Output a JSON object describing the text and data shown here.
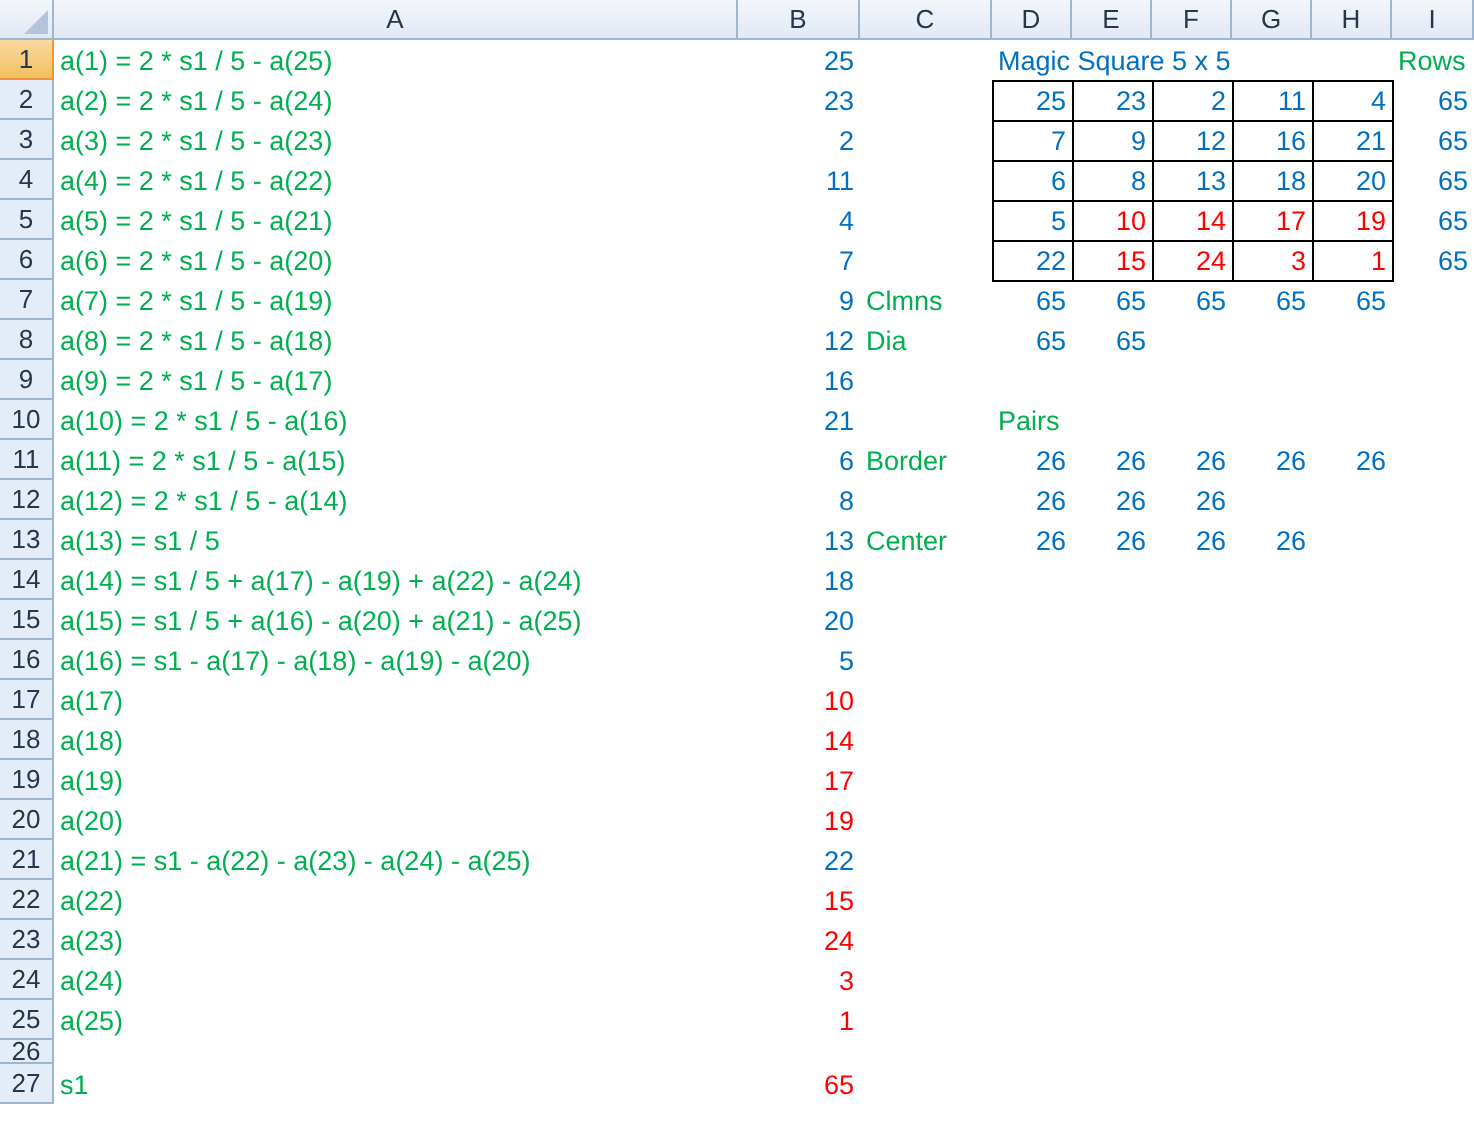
{
  "sheet": {
    "columns": [
      {
        "label": "A",
        "selected": false
      },
      {
        "label": "B",
        "selected": false
      },
      {
        "label": "C",
        "selected": false
      },
      {
        "label": "D",
        "selected": false
      },
      {
        "label": "E",
        "selected": false
      },
      {
        "label": "F",
        "selected": false
      },
      {
        "label": "G",
        "selected": false
      },
      {
        "label": "H",
        "selected": false
      },
      {
        "label": "I",
        "selected": false
      }
    ],
    "rows": [
      {
        "label": "1",
        "selected": true,
        "cells": [
          {
            "text": "a(1) = 2 * s1 / 5 - a(25)",
            "kind": "text",
            "color": "#00b050",
            "bordered": false
          },
          {
            "text": "25",
            "kind": "number",
            "color": "#0070c0",
            "bordered": false
          },
          null,
          {
            "text": "Magic Square 5 x 5",
            "kind": "text",
            "color": "#0070c0",
            "bordered": false
          },
          null,
          null,
          null,
          null,
          {
            "text": "Rows",
            "kind": "text",
            "color": "#00b050",
            "bordered": false
          }
        ]
      },
      {
        "label": "2",
        "selected": false,
        "cells": [
          {
            "text": "a(2) = 2 * s1 / 5 - a(24)",
            "kind": "text",
            "color": "#00b050",
            "bordered": false
          },
          {
            "text": "23",
            "kind": "number",
            "color": "#0070c0",
            "bordered": false
          },
          null,
          {
            "text": "25",
            "kind": "number",
            "color": "#0070c0",
            "bordered": true
          },
          {
            "text": "23",
            "kind": "number",
            "color": "#0070c0",
            "bordered": true
          },
          {
            "text": "2",
            "kind": "number",
            "color": "#0070c0",
            "bordered": true
          },
          {
            "text": "11",
            "kind": "number",
            "color": "#0070c0",
            "bordered": true
          },
          {
            "text": "4",
            "kind": "number",
            "color": "#0070c0",
            "bordered": true
          },
          {
            "text": "65",
            "kind": "number",
            "color": "#0070c0",
            "bordered": false
          }
        ]
      },
      {
        "label": "3",
        "selected": false,
        "cells": [
          {
            "text": "a(3) = 2 * s1 / 5 - a(23)",
            "kind": "text",
            "color": "#00b050",
            "bordered": false
          },
          {
            "text": "2",
            "kind": "number",
            "color": "#0070c0",
            "bordered": false
          },
          null,
          {
            "text": "7",
            "kind": "number",
            "color": "#0070c0",
            "bordered": true
          },
          {
            "text": "9",
            "kind": "number",
            "color": "#0070c0",
            "bordered": true
          },
          {
            "text": "12",
            "kind": "number",
            "color": "#0070c0",
            "bordered": true
          },
          {
            "text": "16",
            "kind": "number",
            "color": "#0070c0",
            "bordered": true
          },
          {
            "text": "21",
            "kind": "number",
            "color": "#0070c0",
            "bordered": true
          },
          {
            "text": "65",
            "kind": "number",
            "color": "#0070c0",
            "bordered": false
          }
        ]
      },
      {
        "label": "4",
        "selected": false,
        "cells": [
          {
            "text": "a(4) = 2 * s1 / 5 - a(22)",
            "kind": "text",
            "color": "#00b050",
            "bordered": false
          },
          {
            "text": "11",
            "kind": "number",
            "color": "#0070c0",
            "bordered": false
          },
          null,
          {
            "text": "6",
            "kind": "number",
            "color": "#0070c0",
            "bordered": true
          },
          {
            "text": "8",
            "kind": "number",
            "color": "#0070c0",
            "bordered": true
          },
          {
            "text": "13",
            "kind": "number",
            "color": "#0070c0",
            "bordered": true
          },
          {
            "text": "18",
            "kind": "number",
            "color": "#0070c0",
            "bordered": true
          },
          {
            "text": "20",
            "kind": "number",
            "color": "#0070c0",
            "bordered": true
          },
          {
            "text": "65",
            "kind": "number",
            "color": "#0070c0",
            "bordered": false
          }
        ]
      },
      {
        "label": "5",
        "selected": false,
        "cells": [
          {
            "text": "a(5) = 2 * s1 / 5 - a(21)",
            "kind": "text",
            "color": "#00b050",
            "bordered": false
          },
          {
            "text": "4",
            "kind": "number",
            "color": "#0070c0",
            "bordered": false
          },
          null,
          {
            "text": "5",
            "kind": "number",
            "color": "#0070c0",
            "bordered": true
          },
          {
            "text": "10",
            "kind": "number",
            "color": "#ff0000",
            "bordered": true
          },
          {
            "text": "14",
            "kind": "number",
            "color": "#ff0000",
            "bordered": true
          },
          {
            "text": "17",
            "kind": "number",
            "color": "#ff0000",
            "bordered": true
          },
          {
            "text": "19",
            "kind": "number",
            "color": "#ff0000",
            "bordered": true
          },
          {
            "text": "65",
            "kind": "number",
            "color": "#0070c0",
            "bordered": false
          }
        ]
      },
      {
        "label": "6",
        "selected": false,
        "cells": [
          {
            "text": "a(6) = 2 * s1 / 5 - a(20)",
            "kind": "text",
            "color": "#00b050",
            "bordered": false
          },
          {
            "text": "7",
            "kind": "number",
            "color": "#0070c0",
            "bordered": false
          },
          null,
          {
            "text": "22",
            "kind": "number",
            "color": "#0070c0",
            "bordered": true
          },
          {
            "text": "15",
            "kind": "number",
            "color": "#ff0000",
            "bordered": true
          },
          {
            "text": "24",
            "kind": "number",
            "color": "#ff0000",
            "bordered": true
          },
          {
            "text": "3",
            "kind": "number",
            "color": "#ff0000",
            "bordered": true
          },
          {
            "text": "1",
            "kind": "number",
            "color": "#ff0000",
            "bordered": true
          },
          {
            "text": "65",
            "kind": "number",
            "color": "#0070c0",
            "bordered": false
          }
        ]
      },
      {
        "label": "7",
        "selected": false,
        "cells": [
          {
            "text": "a(7) = 2 * s1 / 5 - a(19)",
            "kind": "text",
            "color": "#00b050",
            "bordered": false
          },
          {
            "text": "9",
            "kind": "number",
            "color": "#0070c0",
            "bordered": false
          },
          {
            "text": "Clmns",
            "kind": "text",
            "color": "#00b050",
            "bordered": false
          },
          {
            "text": "65",
            "kind": "number",
            "color": "#0070c0",
            "bordered": false
          },
          {
            "text": "65",
            "kind": "number",
            "color": "#0070c0",
            "bordered": false
          },
          {
            "text": "65",
            "kind": "number",
            "color": "#0070c0",
            "bordered": false
          },
          {
            "text": "65",
            "kind": "number",
            "color": "#0070c0",
            "bordered": false
          },
          {
            "text": "65",
            "kind": "number",
            "color": "#0070c0",
            "bordered": false
          }
        ]
      },
      {
        "label": "8",
        "selected": false,
        "cells": [
          {
            "text": "a(8) = 2 * s1 / 5 - a(18)",
            "kind": "text",
            "color": "#00b050",
            "bordered": false
          },
          {
            "text": "12",
            "kind": "number",
            "color": "#0070c0",
            "bordered": false
          },
          {
            "text": "Dia",
            "kind": "text",
            "color": "#00b050",
            "bordered": false
          },
          {
            "text": "65",
            "kind": "number",
            "color": "#0070c0",
            "bordered": false
          },
          {
            "text": "65",
            "kind": "number",
            "color": "#0070c0",
            "bordered": false
          }
        ]
      },
      {
        "label": "9",
        "selected": false,
        "cells": [
          {
            "text": "a(9) = 2 * s1 / 5 - a(17)",
            "kind": "text",
            "color": "#00b050",
            "bordered": false
          },
          {
            "text": "16",
            "kind": "number",
            "color": "#0070c0",
            "bordered": false
          }
        ]
      },
      {
        "label": "10",
        "selected": false,
        "cells": [
          {
            "text": "a(10) = 2 * s1 / 5 - a(16)",
            "kind": "text",
            "color": "#00b050",
            "bordered": false
          },
          {
            "text": "21",
            "kind": "number",
            "color": "#0070c0",
            "bordered": false
          },
          null,
          {
            "text": "Pairs",
            "kind": "text",
            "color": "#00b050",
            "bordered": false
          }
        ]
      },
      {
        "label": "11",
        "selected": false,
        "cells": [
          {
            "text": "a(11) = 2 * s1 / 5 - a(15)",
            "kind": "text",
            "color": "#00b050",
            "bordered": false
          },
          {
            "text": "6",
            "kind": "number",
            "color": "#0070c0",
            "bordered": false
          },
          {
            "text": "Border",
            "kind": "text",
            "color": "#00b050",
            "bordered": false
          },
          {
            "text": "26",
            "kind": "number",
            "color": "#0070c0",
            "bordered": false
          },
          {
            "text": "26",
            "kind": "number",
            "color": "#0070c0",
            "bordered": false
          },
          {
            "text": "26",
            "kind": "number",
            "color": "#0070c0",
            "bordered": false
          },
          {
            "text": "26",
            "kind": "number",
            "color": "#0070c0",
            "bordered": false
          },
          {
            "text": "26",
            "kind": "number",
            "color": "#0070c0",
            "bordered": false
          }
        ]
      },
      {
        "label": "12",
        "selected": false,
        "cells": [
          {
            "text": "a(12) = 2 * s1 / 5 - a(14)",
            "kind": "text",
            "color": "#00b050",
            "bordered": false
          },
          {
            "text": "8",
            "kind": "number",
            "color": "#0070c0",
            "bordered": false
          },
          null,
          {
            "text": "26",
            "kind": "number",
            "color": "#0070c0",
            "bordered": false
          },
          {
            "text": "26",
            "kind": "number",
            "color": "#0070c0",
            "bordered": false
          },
          {
            "text": "26",
            "kind": "number",
            "color": "#0070c0",
            "bordered": false
          }
        ]
      },
      {
        "label": "13",
        "selected": false,
        "cells": [
          {
            "text": "a(13) = s1 / 5",
            "kind": "text",
            "color": "#00b050",
            "bordered": false
          },
          {
            "text": "13",
            "kind": "number",
            "color": "#0070c0",
            "bordered": false
          },
          {
            "text": "Center",
            "kind": "text",
            "color": "#00b050",
            "bordered": false
          },
          {
            "text": "26",
            "kind": "number",
            "color": "#0070c0",
            "bordered": false
          },
          {
            "text": "26",
            "kind": "number",
            "color": "#0070c0",
            "bordered": false
          },
          {
            "text": "26",
            "kind": "number",
            "color": "#0070c0",
            "bordered": false
          },
          {
            "text": "26",
            "kind": "number",
            "color": "#0070c0",
            "bordered": false
          }
        ]
      },
      {
        "label": "14",
        "selected": false,
        "cells": [
          {
            "text": "a(14) = s1 / 5 + a(17) - a(19) + a(22) - a(24)",
            "kind": "text",
            "color": "#00b050",
            "bordered": false
          },
          {
            "text": "18",
            "kind": "number",
            "color": "#0070c0",
            "bordered": false
          }
        ]
      },
      {
        "label": "15",
        "selected": false,
        "cells": [
          {
            "text": "a(15) = s1 / 5 + a(16) - a(20) + a(21) - a(25)",
            "kind": "text",
            "color": "#00b050",
            "bordered": false
          },
          {
            "text": "20",
            "kind": "number",
            "color": "#0070c0",
            "bordered": false
          }
        ]
      },
      {
        "label": "16",
        "selected": false,
        "cells": [
          {
            "text": "a(16) = s1 - a(17) - a(18) - a(19) - a(20)",
            "kind": "text",
            "color": "#00b050",
            "bordered": false
          },
          {
            "text": "5",
            "kind": "number",
            "color": "#0070c0",
            "bordered": false
          }
        ]
      },
      {
        "label": "17",
        "selected": false,
        "cells": [
          {
            "text": "a(17)",
            "kind": "text",
            "color": "#00b050",
            "bordered": false
          },
          {
            "text": "10",
            "kind": "number",
            "color": "#ff0000",
            "bordered": false
          }
        ]
      },
      {
        "label": "18",
        "selected": false,
        "cells": [
          {
            "text": "a(18)",
            "kind": "text",
            "color": "#00b050",
            "bordered": false
          },
          {
            "text": "14",
            "kind": "number",
            "color": "#ff0000",
            "bordered": false
          }
        ]
      },
      {
        "label": "19",
        "selected": false,
        "cells": [
          {
            "text": "a(19)",
            "kind": "text",
            "color": "#00b050",
            "bordered": false
          },
          {
            "text": "17",
            "kind": "number",
            "color": "#ff0000",
            "bordered": false
          }
        ]
      },
      {
        "label": "20",
        "selected": false,
        "cells": [
          {
            "text": "a(20)",
            "kind": "text",
            "color": "#00b050",
            "bordered": false
          },
          {
            "text": "19",
            "kind": "number",
            "color": "#ff0000",
            "bordered": false
          }
        ]
      },
      {
        "label": "21",
        "selected": false,
        "cells": [
          {
            "text": "a(21) = s1 - a(22) - a(23) - a(24) - a(25)",
            "kind": "text",
            "color": "#00b050",
            "bordered": false
          },
          {
            "text": "22",
            "kind": "number",
            "color": "#0070c0",
            "bordered": false
          }
        ]
      },
      {
        "label": "22",
        "selected": false,
        "cells": [
          {
            "text": "a(22)",
            "kind": "text",
            "color": "#00b050",
            "bordered": false
          },
          {
            "text": "15",
            "kind": "number",
            "color": "#ff0000",
            "bordered": false
          }
        ]
      },
      {
        "label": "23",
        "selected": false,
        "cells": [
          {
            "text": "a(23)",
            "kind": "text",
            "color": "#00b050",
            "bordered": false
          },
          {
            "text": "24",
            "kind": "number",
            "color": "#ff0000",
            "bordered": false
          }
        ]
      },
      {
        "label": "24",
        "selected": false,
        "cells": [
          {
            "text": "a(24)",
            "kind": "text",
            "color": "#00b050",
            "bordered": false
          },
          {
            "text": "3",
            "kind": "number",
            "color": "#ff0000",
            "bordered": false
          }
        ]
      },
      {
        "label": "25",
        "selected": false,
        "cells": [
          {
            "text": "a(25)",
            "kind": "text",
            "color": "#00b050",
            "bordered": false
          },
          {
            "text": "1",
            "kind": "number",
            "color": "#ff0000",
            "bordered": false
          }
        ]
      },
      {
        "label": "26",
        "selected": false,
        "cells": []
      },
      {
        "label": "27",
        "selected": false,
        "cells": [
          {
            "text": "s1",
            "kind": "text",
            "color": "#00b050",
            "bordered": false
          },
          {
            "text": "65",
            "kind": "number",
            "color": "#ff0000",
            "bordered": false
          }
        ]
      }
    ]
  }
}
